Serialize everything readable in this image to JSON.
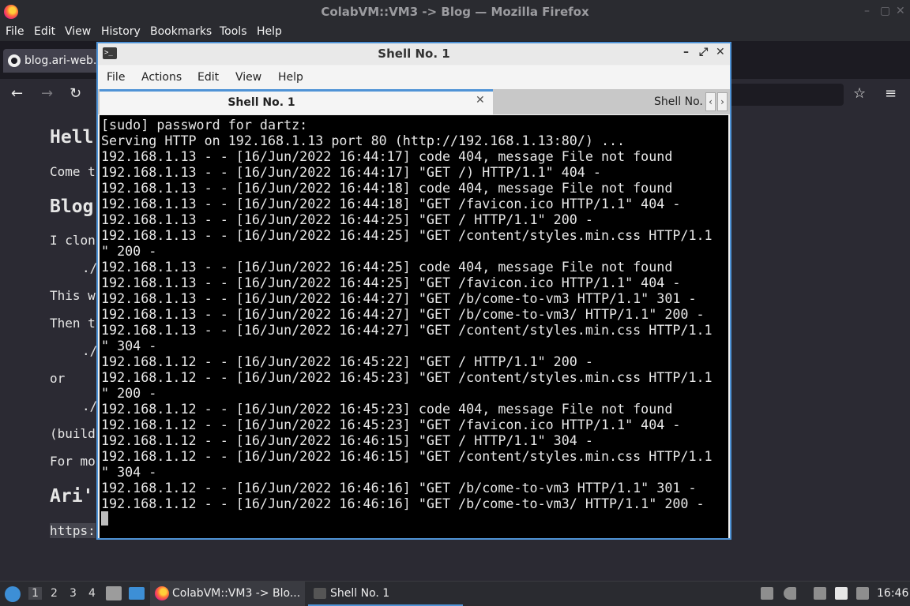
{
  "firefox": {
    "window_title": "ColabVM::VM3 -> Blog — Mozilla Firefox",
    "win_buttons": [
      "–",
      "▢",
      "✕"
    ],
    "menu": [
      "File",
      "Edit",
      "View",
      "History",
      "Bookmarks",
      "Tools",
      "Help"
    ],
    "tab_title": "blog.ari-web.x",
    "nav": {
      "back": "←",
      "forward": "→",
      "reload": "↻",
      "bookmark": "☆",
      "menu": "≡"
    },
    "page": {
      "heading_hello": "Hell",
      "p_come": "Come t",
      "heading_blog": "Blog",
      "p_clone": "I clon",
      "code1": "./",
      "p_this": "This w",
      "p_then": "Then t",
      "code2": "./",
      "p_or": "or",
      "code3": "./",
      "p_build": "(build",
      "p_for": "For mo",
      "heading_ari": "Ari'",
      "link": "https:"
    }
  },
  "terminal": {
    "window_title": "Shell No. 1",
    "win_buttons": [
      "–",
      "⤢",
      "✕"
    ],
    "menu": [
      "File",
      "Actions",
      "Edit",
      "View",
      "Help"
    ],
    "active_tab": "Shell No. 1",
    "other_tab": "Shell No.",
    "tab_close": "✕",
    "scroll_left": "‹",
    "scroll_right": "›",
    "lines": [
      "[sudo] password for dartz:",
      "Serving HTTP on 192.168.1.13 port 80 (http://192.168.1.13:80/) ...",
      "192.168.1.13 - - [16/Jun/2022 16:44:17] code 404, message File not found",
      "192.168.1.13 - - [16/Jun/2022 16:44:17] \"GET /) HTTP/1.1\" 404 -",
      "192.168.1.13 - - [16/Jun/2022 16:44:18] code 404, message File not found",
      "192.168.1.13 - - [16/Jun/2022 16:44:18] \"GET /favicon.ico HTTP/1.1\" 404 -",
      "192.168.1.13 - - [16/Jun/2022 16:44:25] \"GET / HTTP/1.1\" 200 -",
      "192.168.1.13 - - [16/Jun/2022 16:44:25] \"GET /content/styles.min.css HTTP/1.1",
      "\" 200 -",
      "192.168.1.13 - - [16/Jun/2022 16:44:25] code 404, message File not found",
      "192.168.1.13 - - [16/Jun/2022 16:44:25] \"GET /favicon.ico HTTP/1.1\" 404 -",
      "192.168.1.13 - - [16/Jun/2022 16:44:27] \"GET /b/come-to-vm3 HTTP/1.1\" 301 -",
      "192.168.1.13 - - [16/Jun/2022 16:44:27] \"GET /b/come-to-vm3/ HTTP/1.1\" 200 -",
      "192.168.1.13 - - [16/Jun/2022 16:44:27] \"GET /content/styles.min.css HTTP/1.1",
      "\" 304 -",
      "192.168.1.12 - - [16/Jun/2022 16:45:22] \"GET / HTTP/1.1\" 200 -",
      "192.168.1.12 - - [16/Jun/2022 16:45:23] \"GET /content/styles.min.css HTTP/1.1",
      "\" 200 -",
      "192.168.1.12 - - [16/Jun/2022 16:45:23] code 404, message File not found",
      "192.168.1.12 - - [16/Jun/2022 16:45:23] \"GET /favicon.ico HTTP/1.1\" 404 -",
      "192.168.1.12 - - [16/Jun/2022 16:46:15] \"GET / HTTP/1.1\" 304 -",
      "192.168.1.12 - - [16/Jun/2022 16:46:15] \"GET /content/styles.min.css HTTP/1.1",
      "\" 304 -",
      "192.168.1.12 - - [16/Jun/2022 16:46:16] \"GET /b/come-to-vm3 HTTP/1.1\" 301 -",
      "192.168.1.12 - - [16/Jun/2022 16:46:16] \"GET /b/come-to-vm3/ HTTP/1.1\" 200 -"
    ]
  },
  "taskbar": {
    "workspaces": [
      "1",
      "2",
      "3",
      "4"
    ],
    "tasks": [
      "ColabVM::VM3 -> Blo...",
      "Shell No. 1"
    ],
    "clock": "16:46"
  }
}
